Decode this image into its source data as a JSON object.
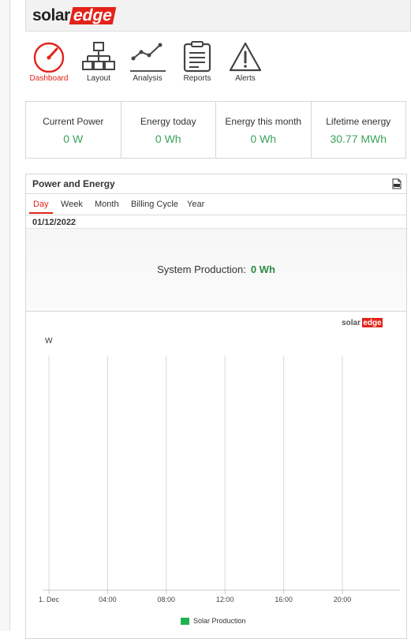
{
  "header": {
    "logo_solar": "solar",
    "logo_edge": "edge"
  },
  "nav": [
    {
      "label": "Dashboard",
      "icon": "speedometer-icon"
    },
    {
      "label": "Layout",
      "icon": "sitemap-icon"
    },
    {
      "label": "Analysis",
      "icon": "line-chart-icon"
    },
    {
      "label": "Reports",
      "icon": "clipboard-icon"
    },
    {
      "label": "Alerts",
      "icon": "warning-icon"
    }
  ],
  "stats": [
    {
      "label": "Current Power",
      "value": "0 W"
    },
    {
      "label": "Energy today",
      "value": "0 Wh"
    },
    {
      "label": "Energy this month",
      "value": "0 Wh"
    },
    {
      "label": "Lifetime energy",
      "value": "30.77 MWh"
    }
  ],
  "panel": {
    "title": "Power and Energy",
    "csv_icon": "csv-export-icon",
    "tabs": [
      "Day",
      "Week",
      "Month",
      "Billing Cycle",
      "Year"
    ],
    "active_tab": "Day",
    "date": "01/12/2022",
    "summary_label": "System Production:",
    "summary_value": "0 Wh"
  },
  "colors": {
    "accent": "#e2231a",
    "value_green": "#3aa35a",
    "series_green": "#1fb34f"
  },
  "chart_data": {
    "type": "line",
    "ylabel": "W",
    "x_ticks": [
      "1. Dec",
      "04:00",
      "08:00",
      "12:00",
      "16:00",
      "20:00"
    ],
    "series": [
      {
        "name": "Solar Production",
        "values": []
      }
    ],
    "watermark_solar": "solar",
    "watermark_edge": "edge"
  }
}
